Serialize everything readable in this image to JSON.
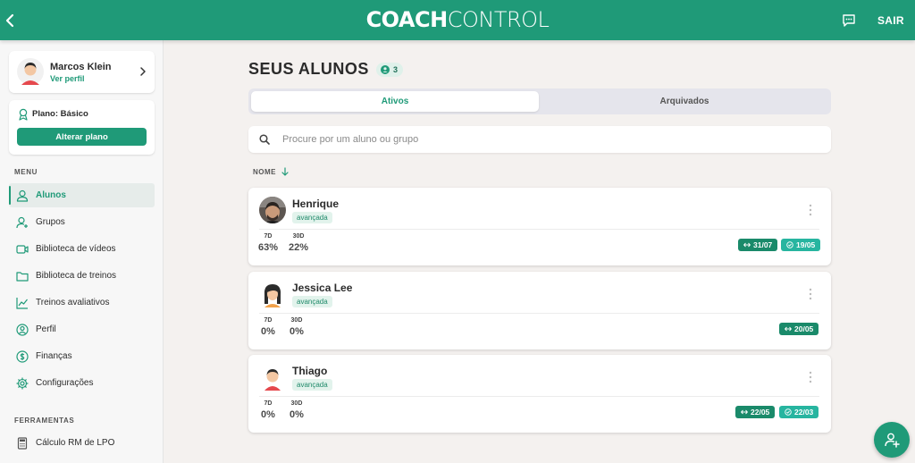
{
  "header": {
    "logo_bold": "COACH",
    "logo_light": "CONTROL",
    "logout_label": "SAIR"
  },
  "sidebar": {
    "profile": {
      "name": "Marcos Klein",
      "link": "Ver perfil"
    },
    "plan": {
      "label": "Plano: Básico",
      "button": "Alterar plano"
    },
    "menu_title": "MENU",
    "items": [
      {
        "label": "Alunos",
        "icon": "user-icon",
        "active": true
      },
      {
        "label": "Grupos",
        "icon": "user-add-icon",
        "active": false
      },
      {
        "label": "Biblioteca de vídeos",
        "icon": "video-icon",
        "active": false
      },
      {
        "label": "Biblioteca de treinos",
        "icon": "folder-icon",
        "active": false
      },
      {
        "label": "Treinos avaliativos",
        "icon": "chart-icon",
        "active": false
      },
      {
        "label": "Perfil",
        "icon": "profile-icon",
        "active": false
      },
      {
        "label": "Finanças",
        "icon": "dollar-icon",
        "active": false
      },
      {
        "label": "Configurações",
        "icon": "gear-icon",
        "active": false
      }
    ],
    "tools_title": "FERRAMENTAS",
    "tools": [
      {
        "label": "Cálculo RM de LPO",
        "icon": "calculator-icon"
      }
    ]
  },
  "main": {
    "title": "SEUS ALUNOS",
    "count": "3",
    "tabs": [
      {
        "label": "Ativos",
        "active": true
      },
      {
        "label": "Arquivados",
        "active": false
      }
    ],
    "search_placeholder": "Procure por um aluno ou grupo",
    "sort_label": "NOME",
    "students": [
      {
        "name": "Henrique",
        "level": "avançada",
        "metrics": [
          {
            "label": "7D",
            "value": "63%"
          },
          {
            "label": "30D",
            "value": "22%"
          }
        ],
        "tags": [
          {
            "text": "31/07",
            "style": "dark"
          },
          {
            "text": "19/05",
            "style": "light"
          }
        ]
      },
      {
        "name": "Jessica Lee",
        "level": "avançada",
        "metrics": [
          {
            "label": "7D",
            "value": "0%"
          },
          {
            "label": "30D",
            "value": "0%"
          }
        ],
        "tags": [
          {
            "text": "20/05",
            "style": "dark"
          }
        ]
      },
      {
        "name": "Thiago",
        "level": "avançada",
        "metrics": [
          {
            "label": "7D",
            "value": "0%"
          },
          {
            "label": "30D",
            "value": "0%"
          }
        ],
        "tags": [
          {
            "text": "22/05",
            "style": "dark"
          },
          {
            "text": "22/03",
            "style": "light"
          }
        ]
      }
    ]
  },
  "colors": {
    "brand": "#1f9a78",
    "background": "#f4f1ef",
    "tag_dark": "#1a8a6a",
    "tag_light": "#27b5a0"
  }
}
